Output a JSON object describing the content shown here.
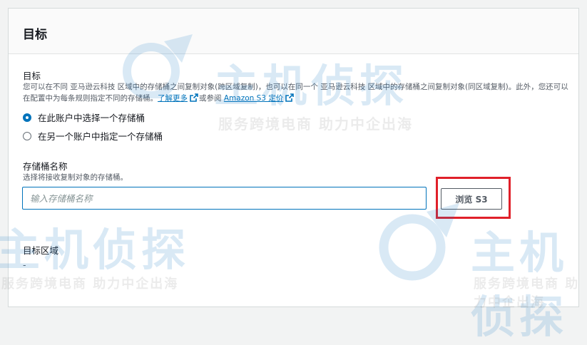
{
  "panel": {
    "title": "目标"
  },
  "destination": {
    "label": "目标",
    "description_part1": "您可以在不同 亚马逊云科技 区域中的存储桶之间复制对象(跨区域复制)，也可以在同一个 亚马逊云科技 区域中的存储桶之间复制对象(同区域复制)。此外，您还可以在配置中为每条规则指定不同的存储桶。",
    "learn_more_link": "了解更多",
    "middle_text": "或参阅",
    "pricing_link": "Amazon S3 定价",
    "options": [
      {
        "label": "在此账户中选择一个存储桶",
        "checked": true
      },
      {
        "label": "在另一个账户中指定一个存储桶",
        "checked": false
      }
    ]
  },
  "bucket": {
    "label": "存储桶名称",
    "description": "选择将接收复制对象的存储桶。",
    "placeholder": "输入存储桶名称",
    "value": "",
    "browse_button": "浏览 S3"
  },
  "region": {
    "label": "目标区域",
    "value": "-"
  },
  "watermark": {
    "logo_text": "主机侦探",
    "slogan": "服务跨境电商 助力中企出海"
  },
  "colors": {
    "accent": "#0073bb",
    "highlight": "#e0202a",
    "watermark": "#1b7ac8"
  }
}
